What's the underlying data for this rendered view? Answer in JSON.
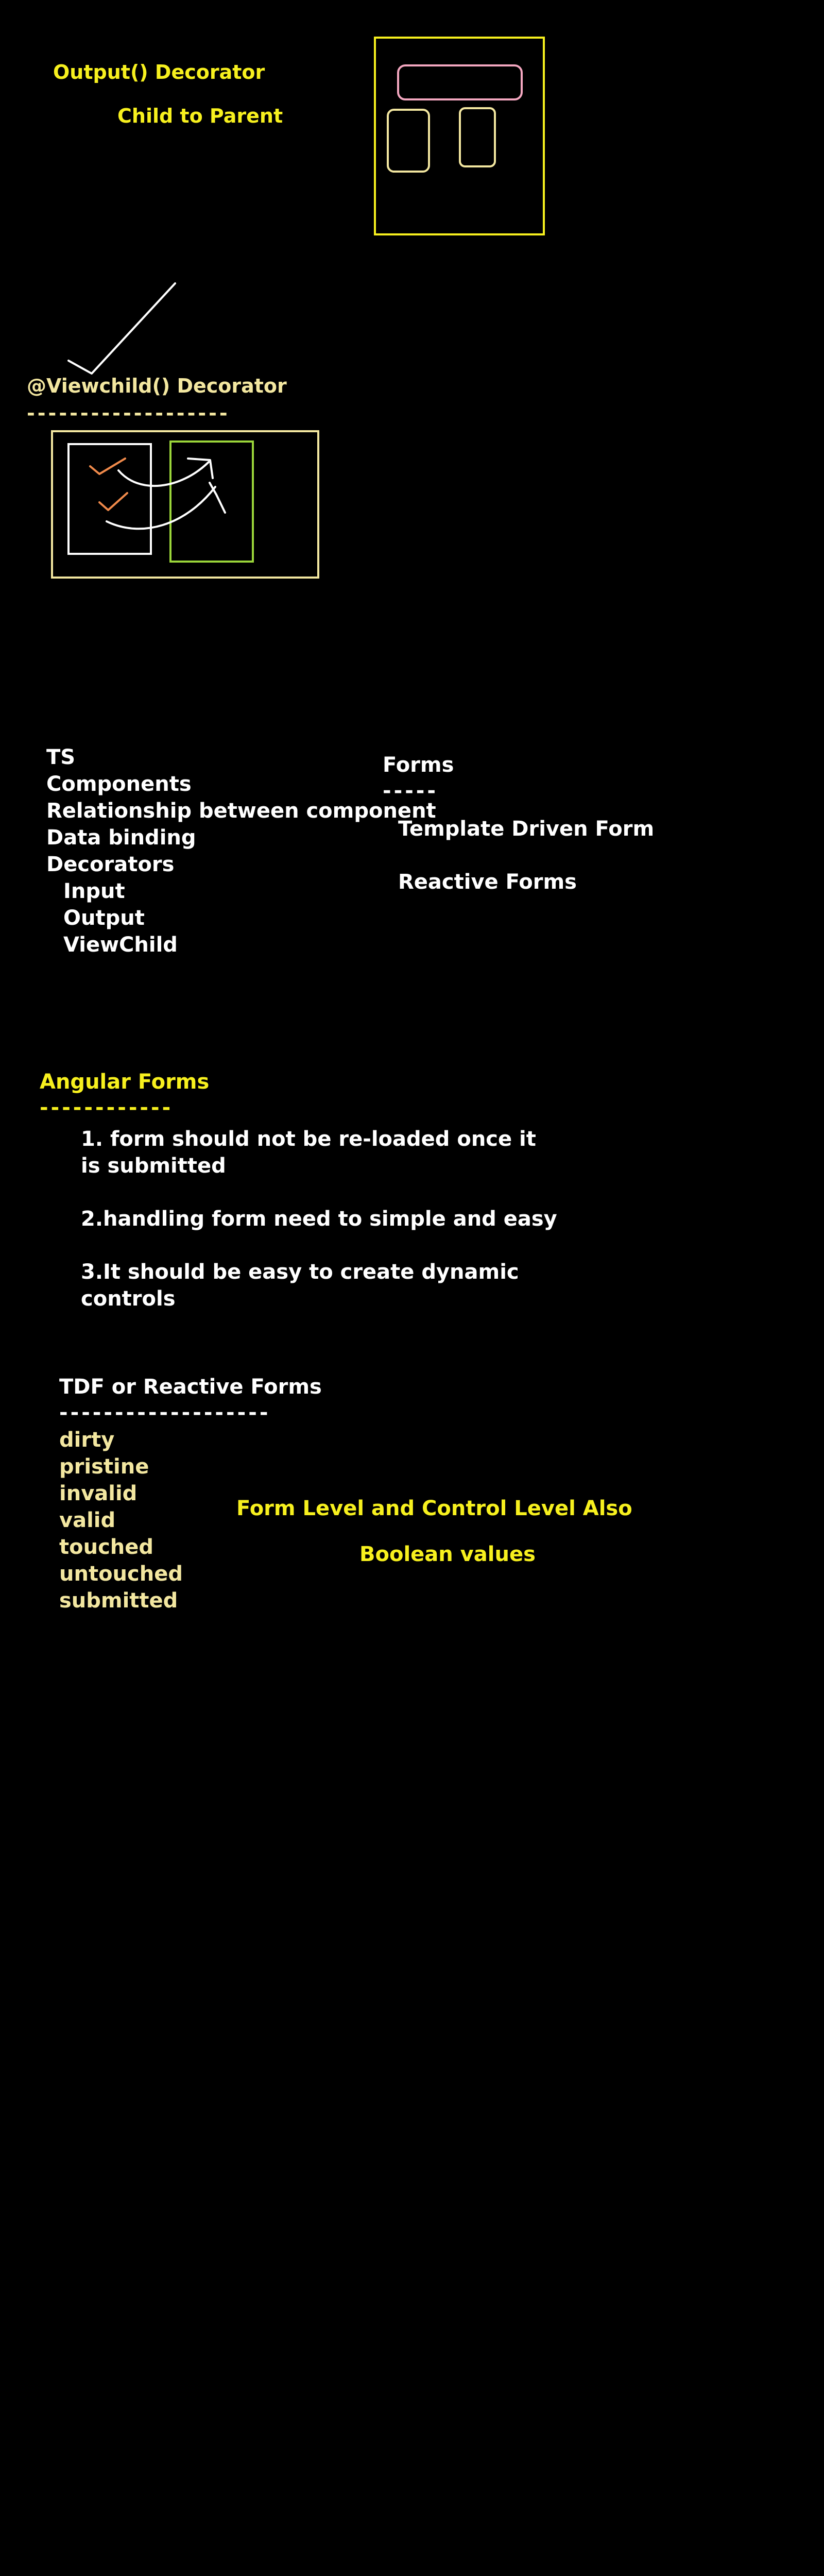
{
  "output_section": {
    "title": "Output() Decorator",
    "subtitle": "Child to Parent"
  },
  "viewchild_section": {
    "title": "@Viewchild() Decorator",
    "underline": "-------------------"
  },
  "topics": {
    "items": [
      "TS",
      "Components",
      "Relationship between component",
      "Data binding",
      "Decorators"
    ],
    "sub_items": [
      "Input",
      "Output",
      "ViewChild"
    ]
  },
  "forms": {
    "title": "Forms",
    "underline": "-----",
    "items": [
      "Template Driven Form",
      "Reactive Forms"
    ]
  },
  "angular_forms": {
    "title": "Angular Forms",
    "underline": "------------",
    "points": [
      [
        "1. form should not be re-loaded once it",
        "is submitted"
      ],
      [
        "2.handling form need to simple and easy"
      ],
      [
        "3.It should be easy to create dynamic",
        "controls"
      ]
    ]
  },
  "states": {
    "title": "TDF or Reactive Forms",
    "underline": "-------------------",
    "items": [
      "dirty",
      "pristine",
      "invalid",
      "valid",
      "touched",
      "untouched",
      "submitted"
    ],
    "note1": "Form Level and Control Level Also",
    "note2": "Boolean values"
  },
  "colors": {
    "background": "#000000",
    "white": "#ffffff",
    "yellow": "#f7f01e",
    "cream": "#f3e7a0",
    "pink": "#f4a7c0",
    "green": "#9bd63a",
    "orange": "#f08a4b"
  }
}
